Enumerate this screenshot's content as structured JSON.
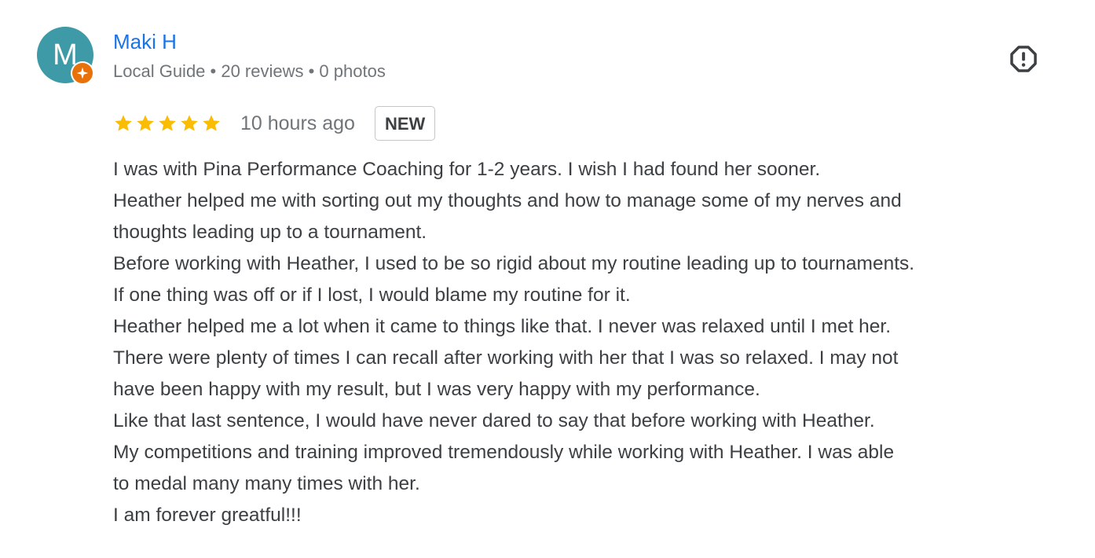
{
  "reviewer": {
    "avatar_letter": "M",
    "avatar_color": "#3d9aa6",
    "badge_icon": "local-guide-star-icon",
    "badge_color": "#e8710a",
    "name": "Maki H",
    "meta": "Local Guide • 20 reviews • 0 photos"
  },
  "report": {
    "icon": "report-flag-icon"
  },
  "rating": {
    "stars": 5,
    "max": 5,
    "star_color": "#fbbc04",
    "time": "10 hours ago",
    "badge": "NEW"
  },
  "review": {
    "lines": [
      "I was with Pina Performance Coaching for 1-2 years. I wish I had found her sooner.",
      "Heather helped me with sorting out my thoughts and how to manage some of my nerves and",
      "thoughts leading up to a tournament.",
      "Before working with Heather, I used to be so rigid about my routine leading up to tournaments.",
      "If one thing was off or if I lost, I would blame my routine for it.",
      "Heather helped me a lot when it came to things like that. I never was relaxed until I met her.",
      "There were plenty of times I can recall after working with her that I was so relaxed. I may not",
      "have been happy with my result, but I was very happy with my performance.",
      "Like that last sentence, I would have never dared to say that before working with Heather.",
      "My competitions and training improved tremendously while working with Heather. I was able",
      "to medal many many times with her.",
      "I am forever greatful!!!"
    ]
  }
}
